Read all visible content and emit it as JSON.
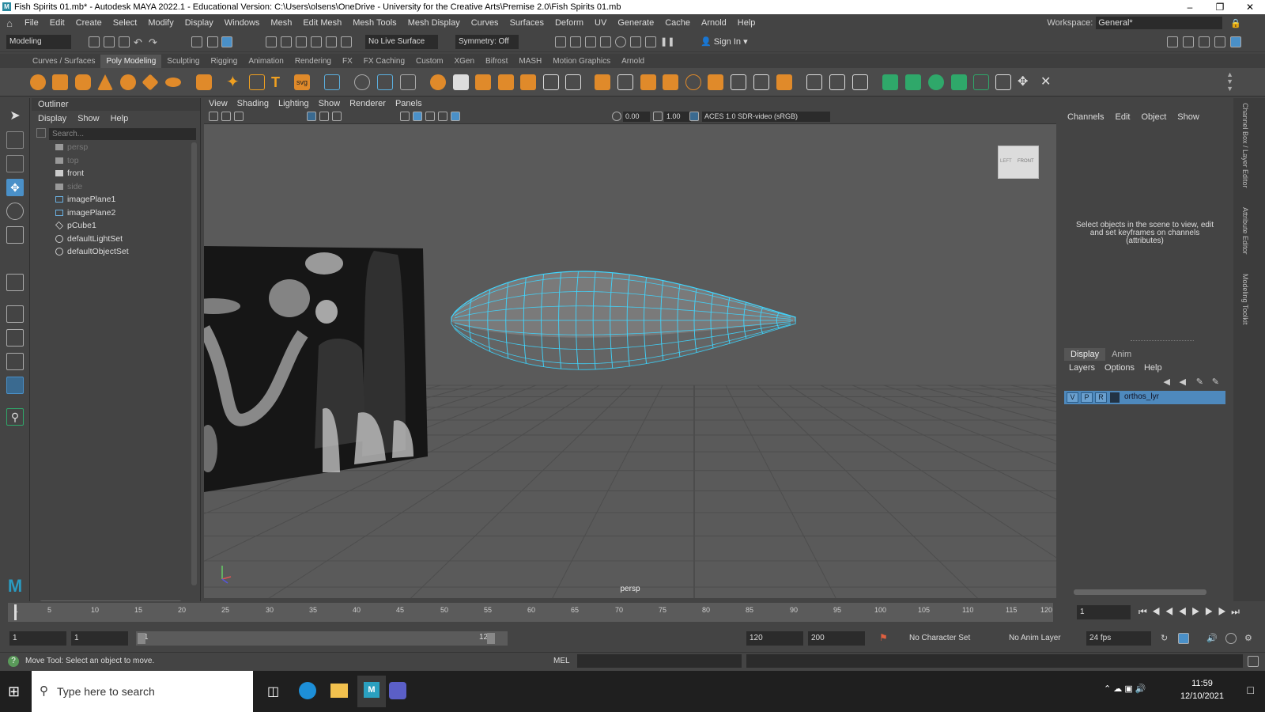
{
  "window": {
    "title": "Fish Spirits 01.mb* - Autodesk MAYA 2022.1 - Educational Version: C:\\Users\\olsens\\OneDrive - University for the Creative Arts\\Premise 2.0\\Fish Spirits 01.mb"
  },
  "menubar": {
    "items": [
      "File",
      "Edit",
      "Create",
      "Select",
      "Modify",
      "Display",
      "Windows",
      "Mesh",
      "Edit Mesh",
      "Mesh Tools",
      "Mesh Display",
      "Curves",
      "Surfaces",
      "Deform",
      "UV",
      "Generate",
      "Cache",
      "Arnold",
      "Help"
    ],
    "workspace_label": "Workspace:",
    "workspace_value": "General*"
  },
  "statusline": {
    "mode": "Modeling",
    "live_surface": "No Live Surface",
    "symmetry": "Symmetry: Off",
    "sign_in": "Sign In"
  },
  "shelf": {
    "tabs": [
      "Curves / Surfaces",
      "Poly Modeling",
      "Sculpting",
      "Rigging",
      "Animation",
      "Rendering",
      "FX",
      "FX Caching",
      "Custom",
      "XGen",
      "Bifrost",
      "MASH",
      "Motion Graphics",
      "Arnold"
    ],
    "active_tab": "Poly Modeling"
  },
  "outliner": {
    "title": "Outliner",
    "menu": [
      "Display",
      "Show",
      "Help"
    ],
    "search_placeholder": "Search...",
    "items": [
      {
        "label": "persp",
        "icon": "camera-icon",
        "dim": true
      },
      {
        "label": "top",
        "icon": "camera-icon",
        "dim": true
      },
      {
        "label": "front",
        "icon": "camera-icon",
        "dim": false
      },
      {
        "label": "side",
        "icon": "camera-icon",
        "dim": true
      },
      {
        "label": "imagePlane1",
        "icon": "image-plane-icon",
        "dim": false
      },
      {
        "label": "imagePlane2",
        "icon": "image-plane-icon",
        "dim": false
      },
      {
        "label": "pCube1",
        "icon": "mesh-icon",
        "dim": false
      },
      {
        "label": "defaultLightSet",
        "icon": "set-icon",
        "dim": false
      },
      {
        "label": "defaultObjectSet",
        "icon": "set-icon",
        "dim": false
      }
    ]
  },
  "viewport": {
    "menu": [
      "View",
      "Shading",
      "Lighting",
      "Show",
      "Renderer",
      "Panels"
    ],
    "field_a": "0.00",
    "field_b": "1.00",
    "colorspace": "ACES 1.0 SDR-video (sRGB)",
    "camera_label": "persp",
    "viewcube_left": "LEFT",
    "viewcube_front": "FRONT"
  },
  "channelbox": {
    "menu": [
      "Channels",
      "Edit",
      "Object",
      "Show"
    ],
    "message": "Select objects in the scene to view, edit and set keyframes on channels (attributes)"
  },
  "layer_editor": {
    "tabs": [
      "Display",
      "Anim"
    ],
    "menu": [
      "Layers",
      "Options",
      "Help"
    ],
    "layer": {
      "v": "V",
      "p": "P",
      "r": "R",
      "name": "orthos_lyr"
    }
  },
  "side_tabs": [
    "Channel Box / Layer Editor",
    "Attribute Editor",
    "Modeling Toolkit"
  ],
  "timeline": {
    "ticks": [
      "1",
      "5",
      "10",
      "15",
      "20",
      "25",
      "30",
      "35",
      "40",
      "45",
      "50",
      "55",
      "60",
      "65",
      "70",
      "75",
      "80",
      "85",
      "90",
      "95",
      "100",
      "105",
      "110",
      "115",
      "120"
    ],
    "current_frame": "1"
  },
  "range": {
    "start": "1",
    "playback_start": "1",
    "slider_start": "1",
    "slider_end": "120",
    "playback_end": "120",
    "end": "200",
    "character_set": "No Character Set",
    "anim_layer": "No Anim Layer",
    "fps": "24 fps"
  },
  "helpline": {
    "message": "Move Tool: Select an object to move.",
    "mel_label": "MEL"
  },
  "taskbar": {
    "search_placeholder": "Type here to search",
    "time": "11:59",
    "date": "12/10/2021"
  },
  "colors": {
    "panel": "#444444",
    "viewport_bg": "#5a5a5a",
    "wireframe": "#3fd6ff",
    "layer_row": "#4e89bd",
    "active_tool": "#4a90c8"
  }
}
